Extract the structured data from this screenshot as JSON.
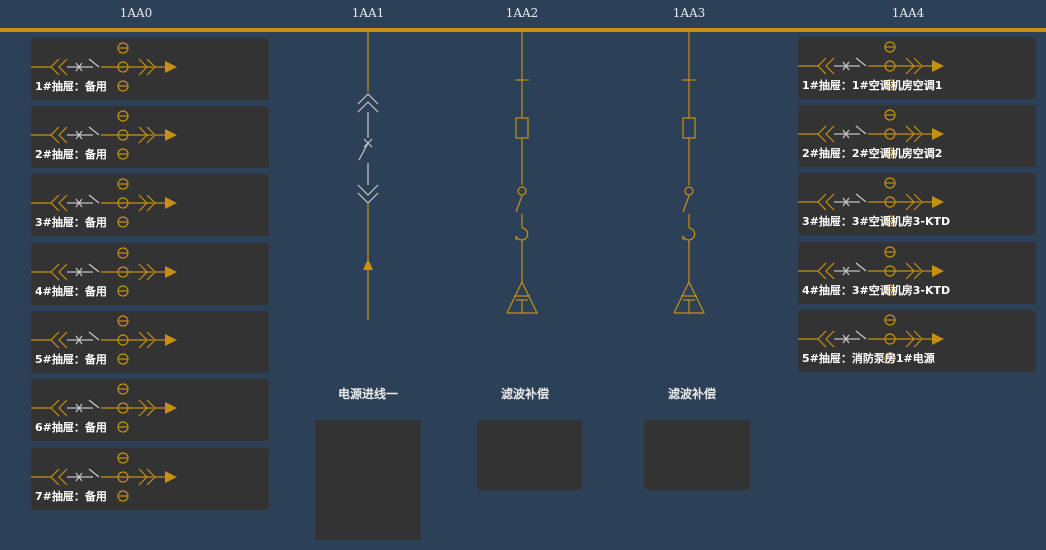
{
  "columns": [
    "1AA0",
    "1AA1",
    "1AA2",
    "1AA3",
    "1AA4"
  ],
  "left_drawers": [
    {
      "label": "1#抽屉：备用"
    },
    {
      "label": "2#抽屉：备用"
    },
    {
      "label": "3#抽屉：备用"
    },
    {
      "label": "4#抽屉：备用"
    },
    {
      "label": "5#抽屉：备用"
    },
    {
      "label": "6#抽屉：备用"
    },
    {
      "label": "7#抽屉：备用"
    }
  ],
  "right_drawers": [
    {
      "label": "1#抽屉：1#空调机房空调1"
    },
    {
      "label": "2#抽屉：2#空调机房空调2"
    },
    {
      "label": "3#抽屉：3#空调机房3-KTD"
    },
    {
      "label": "4#抽屉：3#空调机房3-KTD"
    },
    {
      "label": "5#抽屉：消防泵房1#电源"
    }
  ],
  "feeders": [
    {
      "name": "电源进线一"
    },
    {
      "name": "滤波补偿"
    },
    {
      "name": "滤波补偿"
    }
  ],
  "colors": {
    "background": "#2c4158",
    "busbar": "#c79010",
    "symbol": "#c79010",
    "breaker": "#c8c8c8",
    "panel": "#333333"
  }
}
